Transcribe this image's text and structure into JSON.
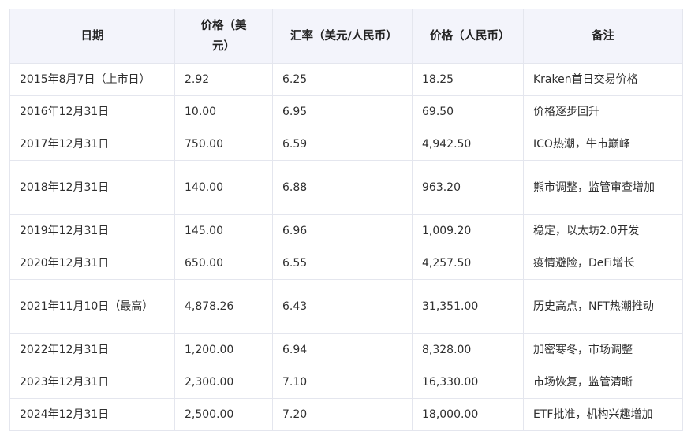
{
  "table": {
    "headers": [
      "日期",
      "价格（美元）",
      "汇率（美元/人民币）",
      "价格（人民币）",
      "备注"
    ],
    "rows": [
      [
        "2015年8月7日（上市日）",
        "2.92",
        "6.25",
        "18.25",
        "Kraken首日交易价格"
      ],
      [
        "2016年12月31日",
        "10.00",
        "6.95",
        "69.50",
        "价格逐步回升"
      ],
      [
        "2017年12月31日",
        "750.00",
        "6.59",
        "4,942.50",
        "ICO热潮，牛市巅峰"
      ],
      [
        "2018年12月31日",
        "140.00",
        "6.88",
        "963.20",
        "熊市调整，监管审查增加"
      ],
      [
        "2019年12月31日",
        "145.00",
        "6.96",
        "1,009.20",
        "稳定，以太坊2.0开发"
      ],
      [
        "2020年12月31日",
        "650.00",
        "6.55",
        "4,257.50",
        "疫情避险，DeFi增长"
      ],
      [
        "2021年11月10日（最高）",
        "4,878.26",
        "6.43",
        "31,351.00",
        "历史高点，NFT热潮推动"
      ],
      [
        "2022年12月31日",
        "1,200.00",
        "6.94",
        "8,328.00",
        "加密寒冬，市场调整"
      ],
      [
        "2023年12月31日",
        "2,300.00",
        "7.10",
        "16,330.00",
        "市场恢复，监管清晰"
      ],
      [
        "2024年12月31日",
        "2,500.00",
        "7.20",
        "18,000.00",
        "ETF批准，机构兴趣增加"
      ]
    ]
  }
}
